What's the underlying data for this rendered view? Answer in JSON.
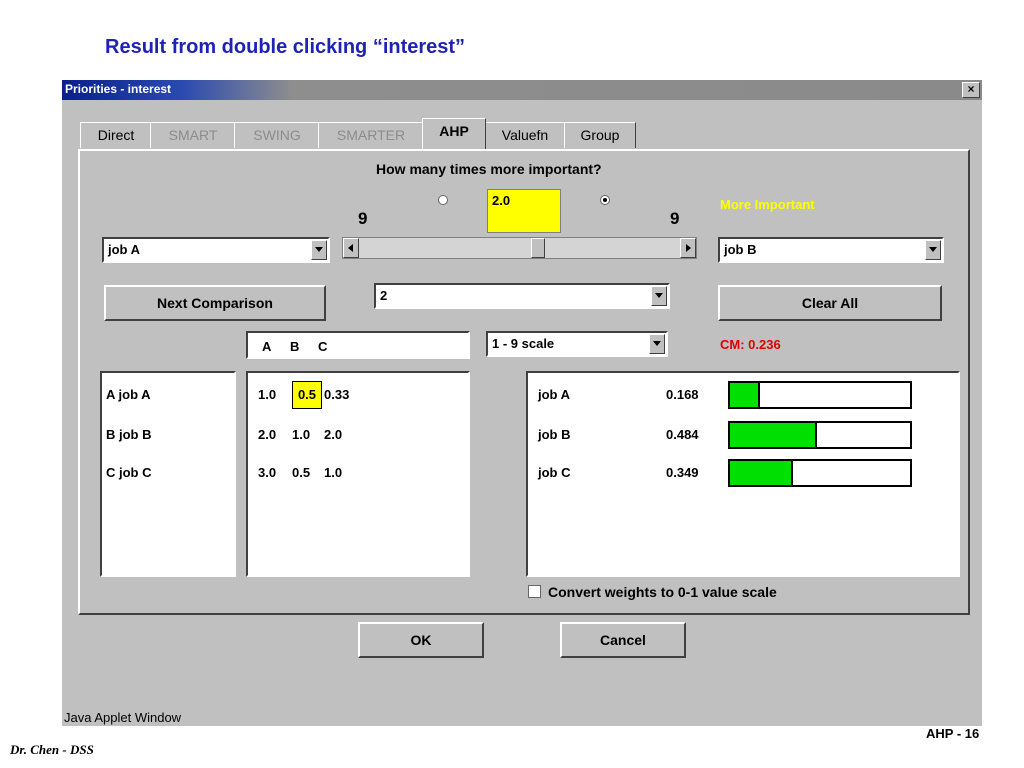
{
  "slide": {
    "title": "Result from double clicking “interest”",
    "footer_left": "Dr. Chen - DSS",
    "footer_right": "AHP - 16"
  },
  "window": {
    "title": "Priorities - interest",
    "close_label": "×",
    "status": "Java Applet Window"
  },
  "tabs": [
    {
      "label": "Direct",
      "enabled": true
    },
    {
      "label": "SMART",
      "enabled": false
    },
    {
      "label": "SWING",
      "enabled": false
    },
    {
      "label": "SMARTER",
      "enabled": false
    },
    {
      "label": "AHP",
      "enabled": true,
      "active": true
    },
    {
      "label": "Valuefn",
      "enabled": true
    },
    {
      "label": "Group",
      "enabled": true
    }
  ],
  "comparison": {
    "question": "How many times more important?",
    "left_max": "9",
    "right_max": "9",
    "value": "2.0",
    "more_important": "More Important",
    "left_item": "job A",
    "right_item": "job B",
    "slider_position": 0.56
  },
  "controls": {
    "next_label": "Next Comparison",
    "comparison_number": "2",
    "clear_label": "Clear All",
    "scale": "1 - 9 scale",
    "cm": "CM: 0.236"
  },
  "matrix": {
    "columns": [
      "A",
      "B",
      "C"
    ],
    "rows": [
      {
        "label": "A job A",
        "values": [
          "1.0",
          "0.5",
          "0.33"
        ]
      },
      {
        "label": "B job B",
        "values": [
          "2.0",
          "1.0",
          "2.0"
        ]
      },
      {
        "label": "C job C",
        "values": [
          "3.0",
          "0.5",
          "1.0"
        ]
      }
    ]
  },
  "weights": [
    {
      "name": "job A",
      "value": "0.168",
      "fraction": 0.168
    },
    {
      "name": "job B",
      "value": "0.484",
      "fraction": 0.484
    },
    {
      "name": "job C",
      "value": "0.349",
      "fraction": 0.349
    }
  ],
  "convert_label": "Convert weights to 0-1 value scale",
  "buttons": {
    "ok": "OK",
    "cancel": "Cancel"
  },
  "colors": {
    "highlight": "#ffff00",
    "bar": "#00e000",
    "cm": "#e00000",
    "title": "#1f23b4"
  }
}
